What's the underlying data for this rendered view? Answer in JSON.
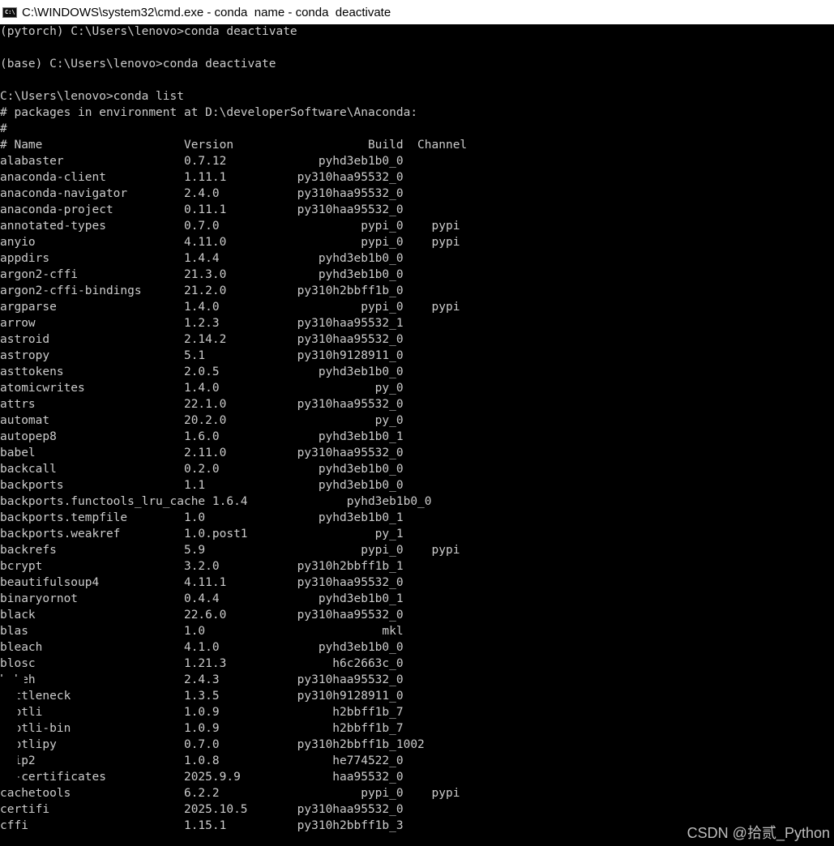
{
  "window": {
    "title": "C:\\WINDOWS\\system32\\cmd.exe - conda  name - conda  deactivate",
    "icon": "cmd-icon",
    "icon_text": "C:\\"
  },
  "console_lines": [
    "(pytorch) C:\\Users\\lenovo>conda deactivate",
    "",
    "(base) C:\\Users\\lenovo>conda deactivate",
    "",
    "C:\\Users\\lenovo>conda list",
    "# packages in environment at D:\\developerSoftware\\Anaconda:",
    "#",
    "# Name                    Version                   Build  Channel",
    "alabaster                 0.7.12             pyhd3eb1b0_0",
    "anaconda-client           1.11.1          py310haa95532_0",
    "anaconda-navigator        2.4.0           py310haa95532_0",
    "anaconda-project          0.11.1          py310haa95532_0",
    "annotated-types           0.7.0                    pypi_0    pypi",
    "anyio                     4.11.0                   pypi_0    pypi",
    "appdirs                   1.4.4              pyhd3eb1b0_0",
    "argon2-cffi               21.3.0             pyhd3eb1b0_0",
    "argon2-cffi-bindings      21.2.0          py310h2bbff1b_0",
    "argparse                  1.4.0                    pypi_0    pypi",
    "arrow                     1.2.3           py310haa95532_1",
    "astroid                   2.14.2          py310haa95532_0",
    "astropy                   5.1             py310h9128911_0",
    "asttokens                 2.0.5              pyhd3eb1b0_0",
    "atomicwrites              1.4.0                      py_0",
    "attrs                     22.1.0          py310haa95532_0",
    "automat                   20.2.0                     py_0",
    "autopep8                  1.6.0              pyhd3eb1b0_1",
    "babel                     2.11.0          py310haa95532_0",
    "backcall                  0.2.0              pyhd3eb1b0_0",
    "backports                 1.1                pyhd3eb1b0_0",
    "backports.functools_lru_cache 1.6.4              pyhd3eb1b0_0",
    "backports.tempfile        1.0                pyhd3eb1b0_1",
    "backports.weakref         1.0.post1                  py_1",
    "backrefs                  5.9                      pypi_0    pypi",
    "bcrypt                    3.2.0           py310h2bbff1b_1",
    "beautifulsoup4            4.11.1          py310haa95532_0",
    "binaryornot               0.4.4              pyhd3eb1b0_1",
    "black                     22.6.0          py310haa95532_0",
    "blas                      1.0                         mkl",
    "bleach                    4.1.0              pyhd3eb1b0_0",
    "blosc                     1.21.3               h6c2663c_0",
    "bokeh                     2.4.3           py310haa95532_0",
    "bottleneck                1.3.5           py310h9128911_0",
    "brotli                    1.0.9                h2bbff1b_7",
    "brotli-bin                1.0.9                h2bbff1b_7",
    "brotlipy                  0.7.0           py310h2bbff1b_1002",
    "bzip2                     1.0.8                he774522_0",
    "ca-certificates           2025.9.9             haa95532_0",
    "cachetools                6.2.2                    pypi_0    pypi",
    "certifi                   2025.10.5       py310haa95532_0",
    "cffi                      1.15.1          py310h2bbff1b_3"
  ],
  "watermark": "CSDN @拾贰_Python"
}
